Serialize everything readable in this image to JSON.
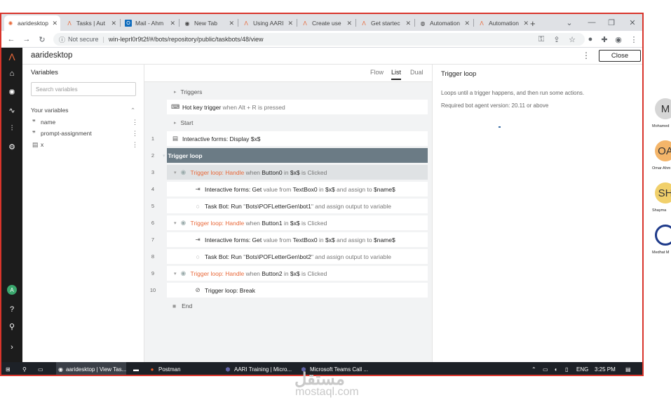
{
  "browser": {
    "tabs": [
      {
        "label": "aaridesktop",
        "icon": "automation-anywhere-icon",
        "active": true
      },
      {
        "label": "Tasks | Aut",
        "icon": "automation-anywhere-icon"
      },
      {
        "label": "Mail - Ahm",
        "icon": "outlook-icon"
      },
      {
        "label": "New Tab",
        "icon": "chrome-icon"
      },
      {
        "label": "Using AARI",
        "icon": "automation-anywhere-icon"
      },
      {
        "label": "Create use",
        "icon": "automation-anywhere-icon"
      },
      {
        "label": "Get startec",
        "icon": "automation-anywhere-icon"
      },
      {
        "label": "Automation",
        "icon": "globe-icon"
      },
      {
        "label": "Automation",
        "icon": "automation-anywhere-icon"
      }
    ],
    "new_tab": "+",
    "security": "Not secure",
    "url": "win-leprl0r9t2f/#/bots/repository/public/taskbots/48/view"
  },
  "app": {
    "title": "aaridesktop",
    "close_label": "Close",
    "kebab": "⋮"
  },
  "variables": {
    "title": "Variables",
    "search_placeholder": "Search variables",
    "section_label": "Your variables",
    "items": [
      {
        "name": "name",
        "icon": "quote-icon"
      },
      {
        "name": "prompt-assignment",
        "icon": "quote-icon"
      },
      {
        "name": "x",
        "icon": "form-icon"
      }
    ]
  },
  "view_tabs": [
    "Flow",
    "List",
    "Dual"
  ],
  "selected_view": "List",
  "flow": {
    "triggers_label": "Triggers",
    "hotkey": {
      "label": "Hot key trigger",
      "detail": "when Alt + R is pressed"
    },
    "start_label": "Start",
    "end_label": "End",
    "lines": [
      {
        "num": "1",
        "parts": [
          {
            "t": "Interactive forms: Display ",
            "c": "b"
          },
          {
            "t": "$x$",
            "c": "b"
          }
        ]
      },
      {
        "num": "2",
        "parts": [
          {
            "t": "Trigger loop",
            "c": "w"
          }
        ]
      },
      {
        "num": "3",
        "parts": [
          {
            "t": "Trigger loop: Handle",
            "c": "o"
          },
          {
            "t": " when ",
            "c": "g"
          },
          {
            "t": "Button0",
            "c": "b"
          },
          {
            "t": " in ",
            "c": "g"
          },
          {
            "t": "$x$",
            "c": "b"
          },
          {
            "t": " is Clicked",
            "c": "g"
          }
        ]
      },
      {
        "num": "4",
        "parts": [
          {
            "t": "Interactive forms: Get",
            "c": "b"
          },
          {
            "t": " value from ",
            "c": "g"
          },
          {
            "t": "TextBox0",
            "c": "b"
          },
          {
            "t": " in ",
            "c": "g"
          },
          {
            "t": "$x$",
            "c": "b"
          },
          {
            "t": " and assign to ",
            "c": "g"
          },
          {
            "t": "$name$",
            "c": "b"
          }
        ]
      },
      {
        "num": "5",
        "parts": [
          {
            "t": "Task Bot: Run",
            "c": "b"
          },
          {
            "t": " \"",
            "c": "g"
          },
          {
            "t": "Bots\\POFLetterGen\\bot1",
            "c": "b"
          },
          {
            "t": "\" and assign output to variable",
            "c": "g"
          }
        ]
      },
      {
        "num": "6",
        "parts": [
          {
            "t": "Trigger loop: Handle",
            "c": "o"
          },
          {
            "t": " when ",
            "c": "g"
          },
          {
            "t": "Button1",
            "c": "b"
          },
          {
            "t": " in ",
            "c": "g"
          },
          {
            "t": "$x$",
            "c": "b"
          },
          {
            "t": " is Clicked",
            "c": "g"
          }
        ]
      },
      {
        "num": "7",
        "parts": [
          {
            "t": "Interactive forms: Get",
            "c": "b"
          },
          {
            "t": " value from ",
            "c": "g"
          },
          {
            "t": "TextBox0",
            "c": "b"
          },
          {
            "t": " in ",
            "c": "g"
          },
          {
            "t": "$x$",
            "c": "b"
          },
          {
            "t": " and assign to ",
            "c": "g"
          },
          {
            "t": "$name$",
            "c": "b"
          }
        ]
      },
      {
        "num": "8",
        "parts": [
          {
            "t": "Task Bot: Run",
            "c": "b"
          },
          {
            "t": " \"",
            "c": "g"
          },
          {
            "t": "Bots\\POFLetterGen\\bot2",
            "c": "b"
          },
          {
            "t": "\" and assign output to variable",
            "c": "g"
          }
        ]
      },
      {
        "num": "9",
        "parts": [
          {
            "t": "Trigger loop: Handle",
            "c": "o"
          },
          {
            "t": " when ",
            "c": "g"
          },
          {
            "t": "Button2",
            "c": "b"
          },
          {
            "t": " in ",
            "c": "g"
          },
          {
            "t": "$x$",
            "c": "b"
          },
          {
            "t": " is Clicked",
            "c": "g"
          }
        ]
      },
      {
        "num": "10",
        "parts": [
          {
            "t": "Trigger loop: Break",
            "c": "b"
          }
        ]
      }
    ]
  },
  "details": {
    "title": "Trigger loop",
    "description": "Loops until a trigger happens, and then run some actions.",
    "version": "Required bot agent version: 20.11 or above"
  },
  "taskbar": {
    "items": [
      {
        "label": "aaridesktop | View Tas..."
      },
      {
        "label": "Postman"
      },
      {
        "label": "AARI Training | Micro..."
      },
      {
        "label": "Microsoft Teams Call ..."
      }
    ],
    "lang": "ENG",
    "time": "3:25 PM"
  },
  "participants": [
    {
      "initials": "M",
      "name": "Mohamed",
      "color": "#d6d6d6"
    },
    {
      "initials": "OA",
      "name": "Omar Ahm",
      "color": "#f4b56a"
    },
    {
      "initials": "SH",
      "name": "Shayma",
      "color": "#f1d06b"
    },
    {
      "initials": "",
      "name": "Medhat M",
      "color": "#ffffff"
    }
  ],
  "watermark": {
    "arabic": "مستقل",
    "latin": "mostaql.com"
  },
  "colors": {
    "accent_orange": "#e8693a",
    "selected_row": "#6b7b85",
    "rail": "#1c1c1c"
  }
}
